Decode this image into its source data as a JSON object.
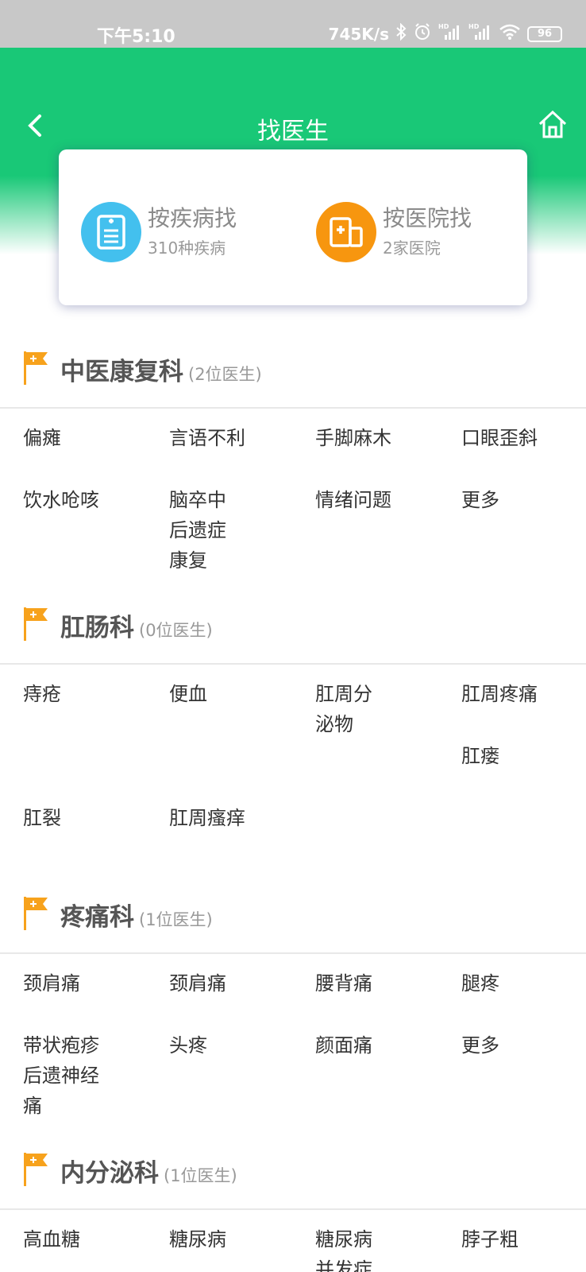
{
  "status_bar": {
    "time": "下午5:10",
    "net_speed": "745K/s",
    "signal_label_1": "HD",
    "signal_label_2": "HD",
    "battery": "96"
  },
  "header": {
    "title": "找医生",
    "back_icon": "chevron-left-icon",
    "home_icon": "home-icon",
    "background_color": "#19c877"
  },
  "search_options": [
    {
      "title": "按疾病找",
      "subtitle": "310种疾病",
      "icon": "clipboard-icon",
      "color": "#43c0ee"
    },
    {
      "title": "按医院找",
      "subtitle": "2家医院",
      "icon": "hospital-icon",
      "color": "#f7960f"
    }
  ],
  "departments": [
    {
      "name": "中医康复科",
      "count": "(2位医生)",
      "items": [
        "偏瘫",
        "言语不利",
        "手脚麻木",
        "口眼歪斜",
        "饮水呛咳",
        "脑卒中后遗症康复",
        "情绪问题",
        "更多"
      ]
    },
    {
      "name": "肛肠科",
      "count": "(0位医生)",
      "items": [
        "痔疮",
        "便血",
        "肛周分泌物",
        "肛周疼痛",
        "肛瘘",
        "肛裂",
        "肛周瘙痒"
      ]
    },
    {
      "name": "疼痛科",
      "count": "(1位医生)",
      "items": [
        "颈肩痛",
        "颈肩痛",
        "腰背痛",
        "腿疼",
        "带状疱疹后遗神经痛",
        "头疼",
        "颜面痛",
        "更多"
      ]
    },
    {
      "name": "内分泌科",
      "count": "(1位医生)",
      "items": [
        "高血糖",
        "糖尿病",
        "糖尿病并发症",
        "脖子粗"
      ]
    }
  ]
}
